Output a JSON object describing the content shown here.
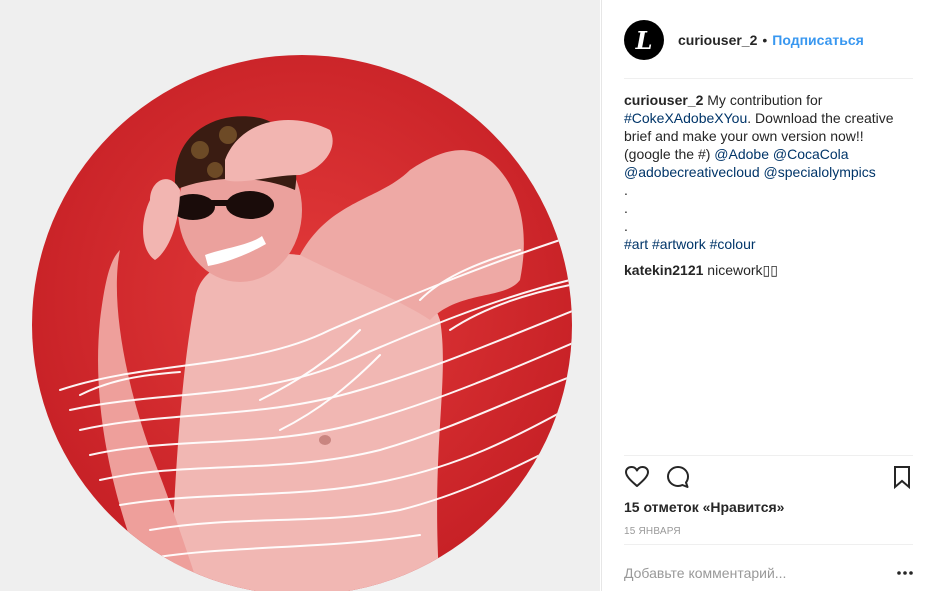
{
  "header": {
    "avatar_letter": "L",
    "username": "curiouser_2",
    "separator": "•",
    "follow_label": "Подписаться"
  },
  "caption": {
    "username": "curiouser_2",
    "text_1": " My contribution for ",
    "hashtag_1": "#CokeXAdobeXYou",
    "text_2": ". Download the creative brief and make your own version now!! (google the #) ",
    "mention_1": "@Adobe",
    "mention_2": "@CocaCola",
    "mention_3": "@adobecreativecloud",
    "mention_4": "@specialolympics",
    "dots": [
      ".",
      ".",
      "."
    ],
    "tag_1": "#art",
    "tag_2": "#artwork",
    "tag_3": "#colour"
  },
  "comment": {
    "username": "katekin2121",
    "text": " nicework▯▯"
  },
  "actions": {
    "like_icon": "heart-icon",
    "comment_icon": "speech-bubble-icon",
    "save_icon": "bookmark-icon"
  },
  "likes_text": "15 отметок «Нравится»",
  "date_text": "15 ЯНВАРЯ",
  "add_comment": {
    "placeholder": "Добавьте комментарий...",
    "more_icon": "more-options-icon"
  },
  "colors": {
    "accent": "#3897f0",
    "link": "#003569",
    "artwork_red": "#d8262b"
  }
}
